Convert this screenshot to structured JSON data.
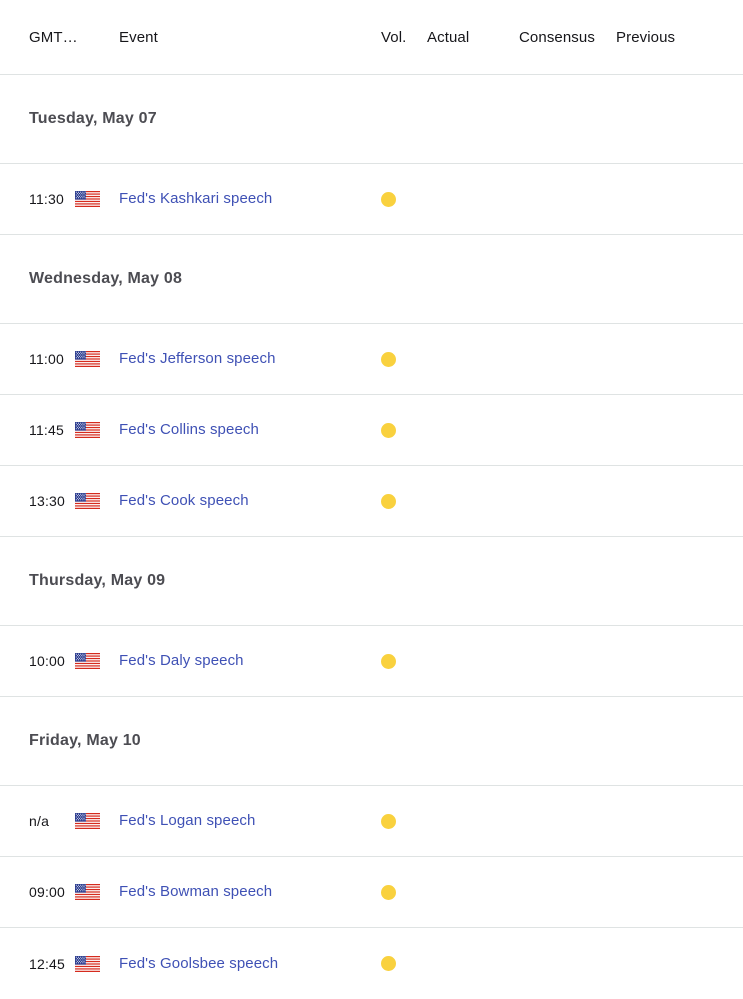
{
  "table": {
    "columns": [
      {
        "key": "time",
        "label": "GMT…"
      },
      {
        "key": "event",
        "label": "Event"
      },
      {
        "key": "vol",
        "label": "Vol."
      },
      {
        "key": "actual",
        "label": "Actual"
      },
      {
        "key": "consensus",
        "label": "Consensus"
      },
      {
        "key": "previous",
        "label": "Previous"
      }
    ],
    "groups": [
      {
        "date": "Tuesday, May 07",
        "rows": [
          {
            "time": "11:30",
            "flag": "us-flag-icon",
            "country": "United States",
            "event": "Fed's Kashkari speech",
            "volatility": "medium",
            "vol_color": "#f9d13e",
            "actual": "",
            "consensus": "",
            "previous": ""
          }
        ]
      },
      {
        "date": "Wednesday, May 08",
        "rows": [
          {
            "time": "11:00",
            "flag": "us-flag-icon",
            "country": "United States",
            "event": "Fed's Jefferson speech",
            "volatility": "medium",
            "vol_color": "#f9d13e",
            "actual": "",
            "consensus": "",
            "previous": ""
          },
          {
            "time": "11:45",
            "flag": "us-flag-icon",
            "country": "United States",
            "event": "Fed's Collins speech",
            "volatility": "medium",
            "vol_color": "#f9d13e",
            "actual": "",
            "consensus": "",
            "previous": ""
          },
          {
            "time": "13:30",
            "flag": "us-flag-icon",
            "country": "United States",
            "event": "Fed's Cook speech",
            "volatility": "medium",
            "vol_color": "#f9d13e",
            "actual": "",
            "consensus": "",
            "previous": ""
          }
        ]
      },
      {
        "date": "Thursday, May 09",
        "rows": [
          {
            "time": "10:00",
            "flag": "us-flag-icon",
            "country": "United States",
            "event": "Fed's Daly speech",
            "volatility": "medium",
            "vol_color": "#f9d13e",
            "actual": "",
            "consensus": "",
            "previous": ""
          }
        ]
      },
      {
        "date": "Friday, May 10",
        "rows": [
          {
            "time": "n/a",
            "flag": "us-flag-icon",
            "country": "United States",
            "event": "Fed's Logan speech",
            "volatility": "medium",
            "vol_color": "#f9d13e",
            "actual": "",
            "consensus": "",
            "previous": ""
          },
          {
            "time": "09:00",
            "flag": "us-flag-icon",
            "country": "United States",
            "event": "Fed's Bowman speech",
            "volatility": "medium",
            "vol_color": "#f9d13e",
            "actual": "",
            "consensus": "",
            "previous": ""
          },
          {
            "time": "12:45",
            "flag": "us-flag-icon",
            "country": "United States",
            "event": "Fed's Goolsbee speech",
            "volatility": "medium",
            "vol_color": "#f9d13e",
            "actual": "",
            "consensus": "",
            "previous": ""
          }
        ]
      }
    ]
  }
}
